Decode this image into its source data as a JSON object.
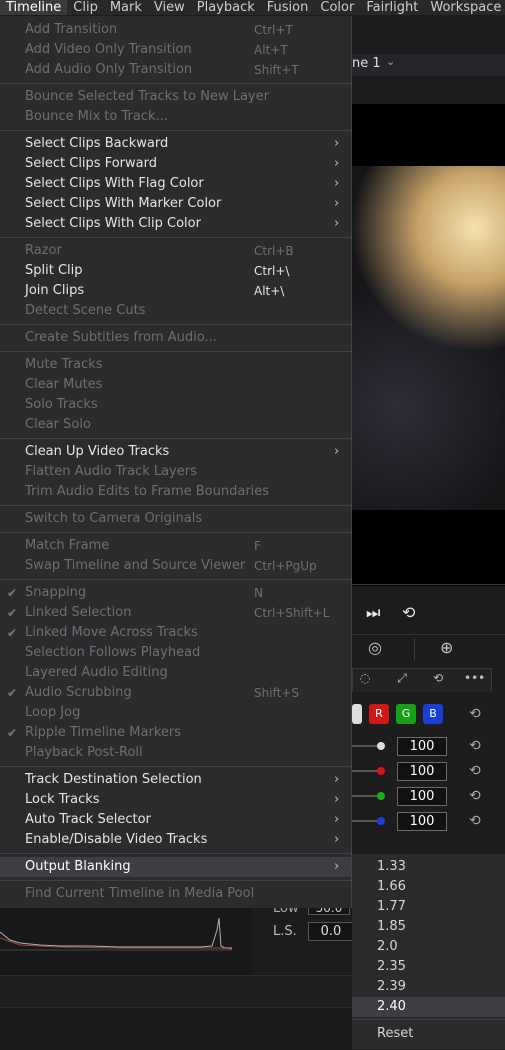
{
  "menubar": [
    "Timeline",
    "Clip",
    "Mark",
    "View",
    "Playback",
    "Fusion",
    "Color",
    "Fairlight",
    "Workspace"
  ],
  "background": {
    "timeline_name": "ne 1",
    "rgb_buttons": [
      "R",
      "G",
      "B"
    ],
    "values": [
      "100",
      "100",
      "100",
      "100"
    ],
    "low_label": "Low",
    "low_value": "50.0",
    "ls_label": "L.S.",
    "ls_value": "0.0"
  },
  "timeline_menu": {
    "groups": [
      [
        {
          "label": "Add Transition",
          "shortcut": "Ctrl+T",
          "enabled": false
        },
        {
          "label": "Add Video Only Transition",
          "shortcut": "Alt+T",
          "enabled": false
        },
        {
          "label": "Add Audio Only Transition",
          "shortcut": "Shift+T",
          "enabled": false
        }
      ],
      [
        {
          "label": "Bounce Selected Tracks to New Layer",
          "enabled": false
        },
        {
          "label": "Bounce Mix to Track...",
          "enabled": false
        }
      ],
      [
        {
          "label": "Select Clips Backward",
          "enabled": true,
          "submenu": true
        },
        {
          "label": "Select Clips Forward",
          "enabled": true,
          "submenu": true
        },
        {
          "label": "Select Clips With Flag Color",
          "enabled": true,
          "submenu": true
        },
        {
          "label": "Select Clips With Marker Color",
          "enabled": true,
          "submenu": true
        },
        {
          "label": "Select Clips With Clip Color",
          "enabled": true,
          "submenu": true
        }
      ],
      [
        {
          "label": "Razor",
          "shortcut": "Ctrl+B",
          "enabled": false
        },
        {
          "label": "Split Clip",
          "shortcut": "Ctrl+\\",
          "enabled": true
        },
        {
          "label": "Join Clips",
          "shortcut": "Alt+\\",
          "enabled": true
        },
        {
          "label": "Detect Scene Cuts",
          "enabled": false
        }
      ],
      [
        {
          "label": "Create Subtitles from Audio...",
          "enabled": false
        }
      ],
      [
        {
          "label": "Mute Tracks",
          "enabled": false
        },
        {
          "label": "Clear Mutes",
          "enabled": false
        },
        {
          "label": "Solo Tracks",
          "enabled": false
        },
        {
          "label": "Clear Solo",
          "enabled": false
        }
      ],
      [
        {
          "label": "Clean Up Video Tracks",
          "enabled": true,
          "submenu": true
        },
        {
          "label": "Flatten Audio Track Layers",
          "enabled": false
        },
        {
          "label": "Trim Audio Edits to Frame Boundaries",
          "enabled": false
        }
      ],
      [
        {
          "label": "Switch to Camera Originals",
          "enabled": false
        }
      ],
      [
        {
          "label": "Match Frame",
          "shortcut": "F",
          "enabled": false
        },
        {
          "label": "Swap Timeline and Source Viewer",
          "shortcut": "Ctrl+PgUp",
          "enabled": false
        }
      ],
      [
        {
          "label": "Snapping",
          "shortcut": "N",
          "enabled": false,
          "checked": true
        },
        {
          "label": "Linked Selection",
          "shortcut": "Ctrl+Shift+L",
          "enabled": false,
          "checked": true
        },
        {
          "label": "Linked Move Across Tracks",
          "enabled": false,
          "checked": true
        },
        {
          "label": "Selection Follows Playhead",
          "enabled": false
        },
        {
          "label": "Layered Audio Editing",
          "enabled": false
        },
        {
          "label": "Audio Scrubbing",
          "shortcut": "Shift+S",
          "enabled": false,
          "checked": true
        },
        {
          "label": "Loop Jog",
          "enabled": false
        },
        {
          "label": "Ripple Timeline Markers",
          "enabled": false,
          "checked": true
        },
        {
          "label": "Playback Post-Roll",
          "enabled": false
        }
      ],
      [
        {
          "label": "Track Destination Selection",
          "enabled": true,
          "submenu": true
        },
        {
          "label": "Lock Tracks",
          "enabled": true,
          "submenu": true
        },
        {
          "label": "Auto Track Selector",
          "enabled": true,
          "submenu": true
        },
        {
          "label": "Enable/Disable Video Tracks",
          "enabled": true,
          "submenu": true
        }
      ],
      [
        {
          "label": "Output Blanking",
          "enabled": true,
          "submenu": true,
          "highlighted": true
        }
      ],
      [
        {
          "label": "Find Current Timeline in Media Pool",
          "enabled": false
        }
      ]
    ]
  },
  "output_blanking_submenu": {
    "items": [
      "1.33",
      "1.66",
      "1.77",
      "1.85",
      "2.0",
      "2.35",
      "2.39",
      "2.40"
    ],
    "selected": "2.40",
    "reset_label": "Reset"
  }
}
